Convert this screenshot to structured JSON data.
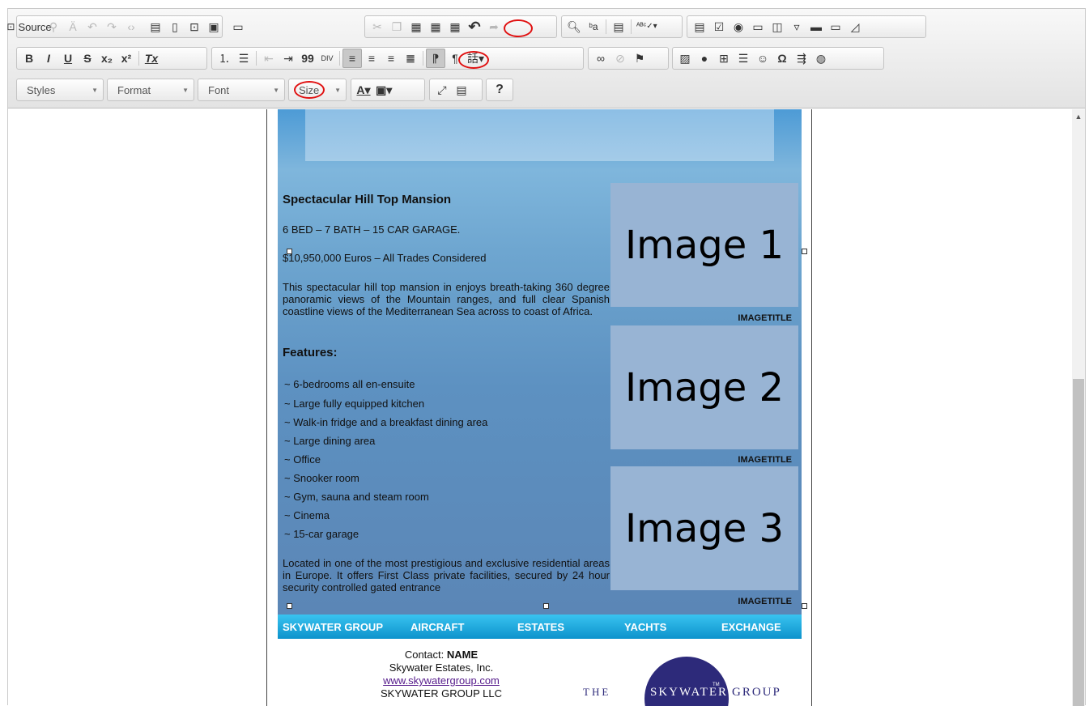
{
  "toolbar": {
    "source_label": "Source",
    "row1_icons": [
      "save-icon",
      "new-page-icon",
      "preview-icon",
      "print-icon",
      "templates-icon",
      "cut-icon",
      "copy-icon",
      "paste-icon",
      "paste-text-icon",
      "paste-word-icon",
      "undo-icon",
      "redo-icon",
      "find-icon",
      "replace-icon",
      "select-all-icon",
      "spellcheck-icon",
      "form-icon",
      "checkbox-icon",
      "radio-icon",
      "textfield-icon",
      "textarea-icon",
      "select-icon",
      "button-icon",
      "imagebutton-icon",
      "hiddenfield-icon"
    ],
    "styles_label": "Styles",
    "format_label": "Format",
    "font_label": "Font",
    "size_label": "Size",
    "help_label": "?"
  },
  "highlight_color": "#e01010",
  "document": {
    "heading": "Spectacular Hill Top Mansion",
    "specs": "6 BED – 7 BATH – 15 CAR GARAGE.",
    "price": "$10,950,000 Euros – All Trades Considered",
    "description": "This spectacular hill top mansion in enjoys breath-taking 360 degree panoramic views of the Mountain ranges, and full clear Spanish coastline views of the Mediterranean Sea across to coast of Africa.",
    "features_heading": "Features:",
    "features": [
      "~ 6-bedrooms all en-ensuite",
      "~ Large fully equipped kitchen",
      "~ Walk-in fridge and a breakfast dining area",
      "~ Large dining area",
      "~ Office",
      "~ Snooker room",
      "~ Gym, sauna and steam room",
      "~ Cinema",
      "~ 15-car garage"
    ],
    "location": "Located in one of the most prestigious and exclusive residential areas in Europe. It offers First Class private facilities, secured by 24 hour security controlled gated entrance",
    "images": [
      {
        "label": "Image 1",
        "title": "IMAGETITLE"
      },
      {
        "label": "Image 2",
        "title": "IMAGETITLE"
      },
      {
        "label": "Image 3",
        "title": "IMAGETITLE"
      }
    ],
    "nav": [
      "SKYWATER GROUP",
      "AIRCRAFT",
      "ESTATES",
      "YACHTS",
      "EXCHANGE"
    ],
    "contact": {
      "prefix": "Contact:",
      "name": "NAME",
      "company": "Skywater Estates, Inc.",
      "url": "www.skywatergroup.com",
      "group": "SKYWATER GROUP LLC"
    },
    "logo": {
      "the": "THE",
      "name": "SKYWATER",
      "tm": "TM",
      "group": "GROUP"
    }
  }
}
